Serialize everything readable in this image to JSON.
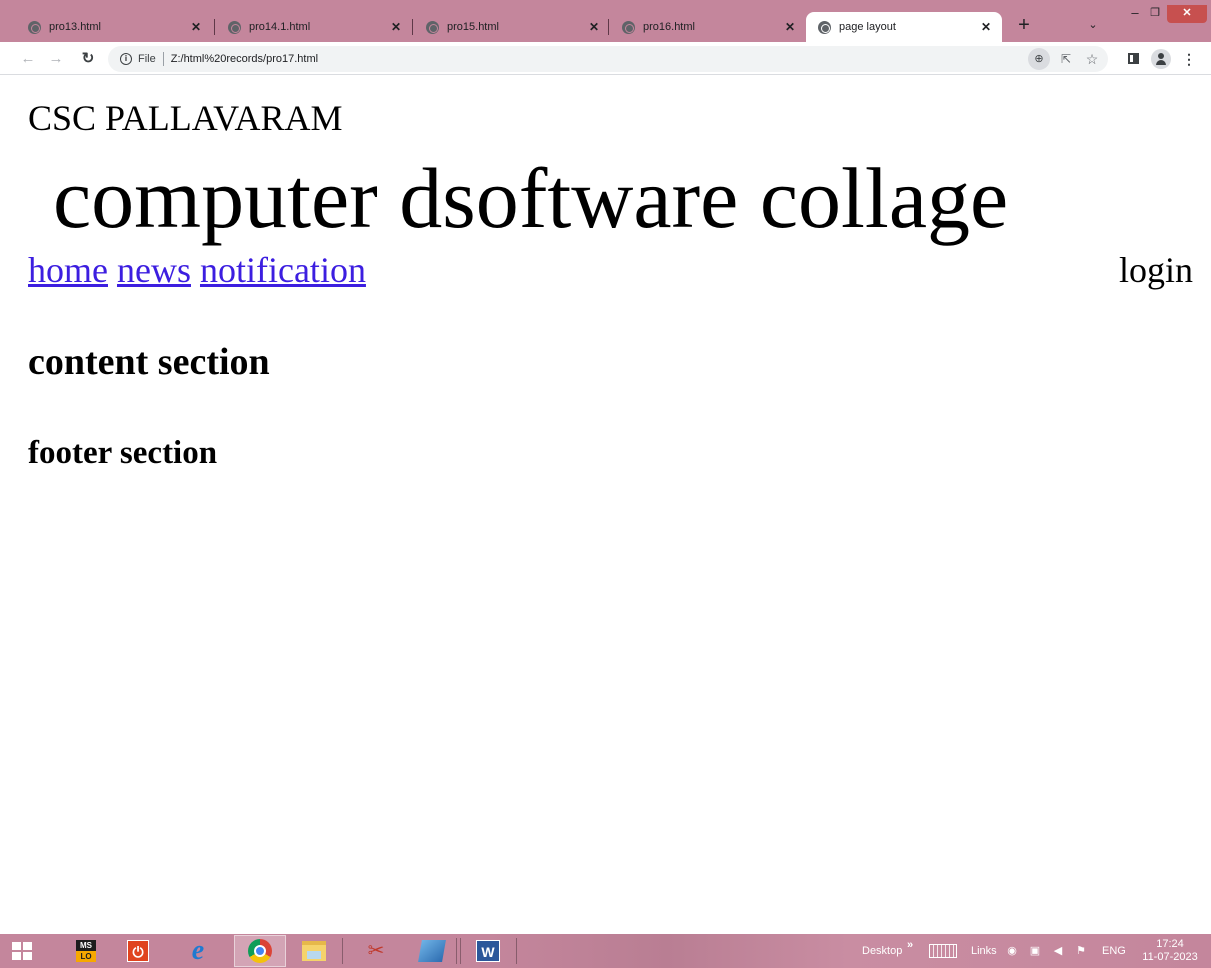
{
  "browser": {
    "tabs": [
      {
        "title": "pro13.html",
        "active": false
      },
      {
        "title": "pro14.1.html",
        "active": false
      },
      {
        "title": "pro15.html",
        "active": false
      },
      {
        "title": "pro16.html",
        "active": false
      },
      {
        "title": "page layout",
        "active": true
      }
    ],
    "new_tab_label": "+",
    "address_bar": {
      "scheme_label": "File",
      "url": "Z:/html%20records/pro17.html"
    }
  },
  "page": {
    "subtitle": "CSC PALLAVARAM",
    "title": "computer dsoftware collage",
    "nav": {
      "links": [
        "home",
        "news",
        "notification"
      ],
      "login": "login"
    },
    "content_heading": "content section",
    "footer_heading": "footer section"
  },
  "taskbar": {
    "apps": [
      "start-icon",
      "ms-office-icon",
      "power-icon",
      "internet-explorer-icon",
      "chrome-icon",
      "file-explorer-icon",
      "snipping-tool-icon",
      "windows-app-icon",
      "word-icon"
    ],
    "desktop_label": "Desktop",
    "links_label": "Links",
    "language": "ENG",
    "time": "17:24",
    "date": "11-07-2023"
  },
  "colors": {
    "chrome_frame": "#c4869c",
    "link_color": "#3c1ee0",
    "close_button": "#c7504f"
  }
}
